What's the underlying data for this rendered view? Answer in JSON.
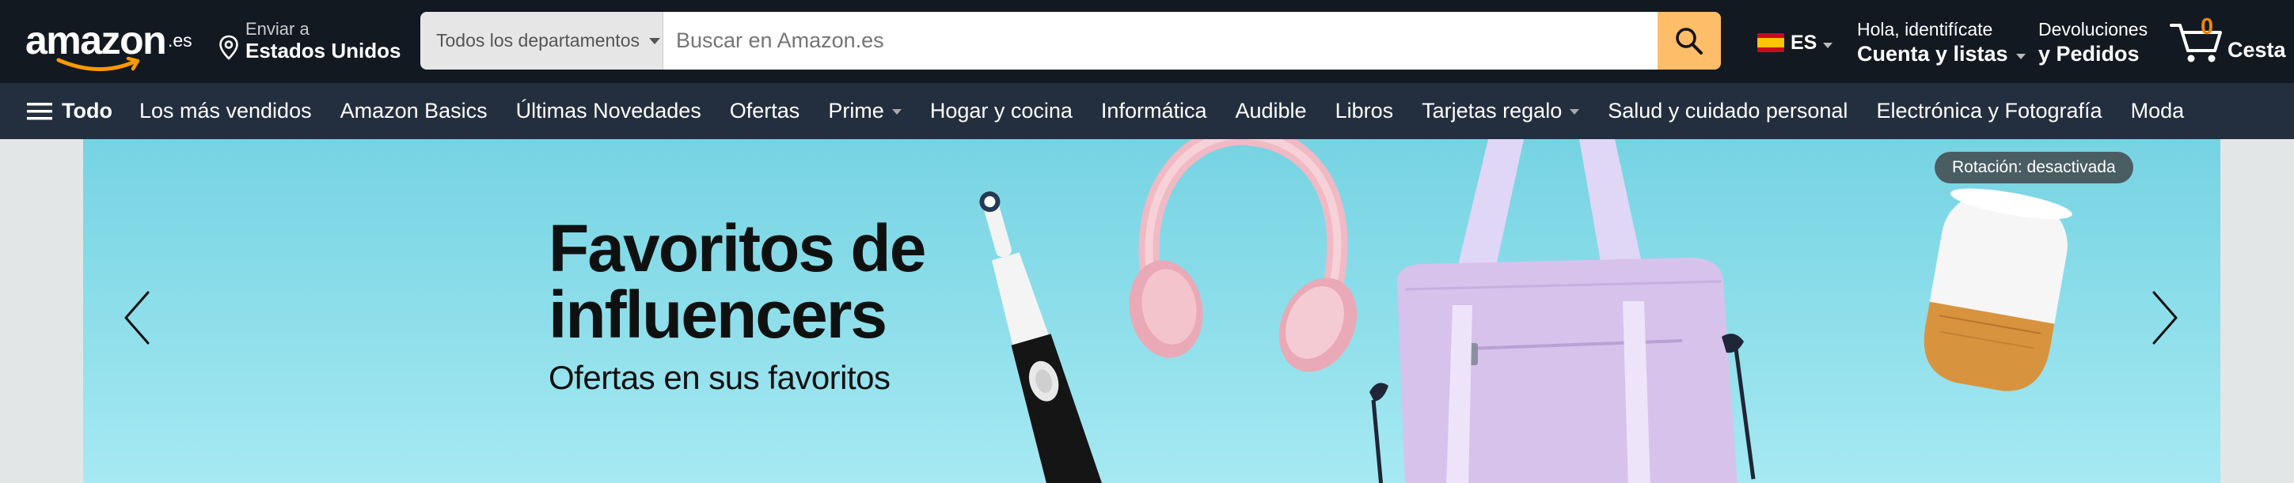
{
  "header": {
    "logo": {
      "word": "amazon",
      "tld": ".es"
    },
    "deliver": {
      "line1": "Enviar a",
      "line2": "Estados Unidos"
    },
    "search": {
      "department": "Todos los departamentos",
      "placeholder": "Buscar en Amazon.es"
    },
    "language": {
      "code": "ES",
      "flag": "spain-flag-icon"
    },
    "account": {
      "line1": "Hola, identifícate",
      "line2": "Cuenta y listas"
    },
    "returns": {
      "line1": "Devoluciones",
      "line2": "y Pedidos"
    },
    "cart": {
      "count": "0",
      "label": "Cesta"
    }
  },
  "subnav": {
    "menu_label": "Todo",
    "items": [
      {
        "label": "Los más vendidos"
      },
      {
        "label": "Amazon Basics"
      },
      {
        "label": "Últimas Novedades"
      },
      {
        "label": "Ofertas"
      },
      {
        "label": "Prime"
      },
      {
        "label": "Hogar y cocina"
      },
      {
        "label": "Informática"
      },
      {
        "label": "Audible"
      },
      {
        "label": "Libros"
      },
      {
        "label": "Tarjetas regalo"
      },
      {
        "label": "Salud y cuidado personal"
      },
      {
        "label": "Electrónica y Fotografía"
      },
      {
        "label": "Moda"
      }
    ]
  },
  "hero": {
    "title_line1": "Favoritos de",
    "title_line2": "influencers",
    "subtitle": "Ofertas en sus favoritos",
    "rotation_badge": "Rotación: desactivada"
  },
  "colors": {
    "topnav_bg": "#131921",
    "subnav_bg": "#232f3e",
    "search_button": "#febd69",
    "cart_count": "#f08804",
    "hero_bg": "#8fdfeb"
  }
}
